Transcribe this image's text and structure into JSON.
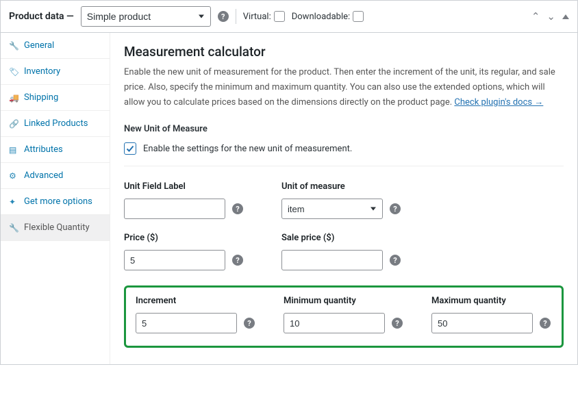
{
  "header": {
    "title": "Product data —",
    "product_type": "Simple product",
    "virtual_label": "Virtual:",
    "downloadable_label": "Downloadable:"
  },
  "sidebar": {
    "items": [
      {
        "icon": "wrench",
        "label": "General"
      },
      {
        "icon": "tag",
        "label": "Inventory"
      },
      {
        "icon": "truck",
        "label": "Shipping"
      },
      {
        "icon": "link",
        "label": "Linked Products"
      },
      {
        "icon": "list",
        "label": "Attributes"
      },
      {
        "icon": "gear",
        "label": "Advanced"
      },
      {
        "icon": "spark",
        "label": "Get more options"
      },
      {
        "icon": "wrench2",
        "label": "Flexible Quantity",
        "active": true
      }
    ]
  },
  "content": {
    "heading": "Measurement calculator",
    "description": "Enable the new unit of measurement for the product. Then enter the increment of the unit, its regular, and sale price. Also, specify the minimum and maximum quantity. You can also use the extended options, which will allow you to calculate prices based on the dimensions directly on the product page. ",
    "docs_link": "Check plugin's docs →",
    "new_unit_heading": "New Unit of Measure",
    "enable_label": "Enable the settings for the new unit of measurement.",
    "fields": {
      "unit_field_label": {
        "label": "Unit Field Label",
        "value": ""
      },
      "unit_of_measure": {
        "label": "Unit of measure",
        "value": "item"
      },
      "price": {
        "label": "Price ($)",
        "value": "5"
      },
      "sale_price": {
        "label": "Sale price ($)",
        "value": ""
      },
      "increment": {
        "label": "Increment",
        "value": "5"
      },
      "min_qty": {
        "label": "Minimum quantity",
        "value": "10"
      },
      "max_qty": {
        "label": "Maximum quantity",
        "value": "50"
      }
    }
  }
}
